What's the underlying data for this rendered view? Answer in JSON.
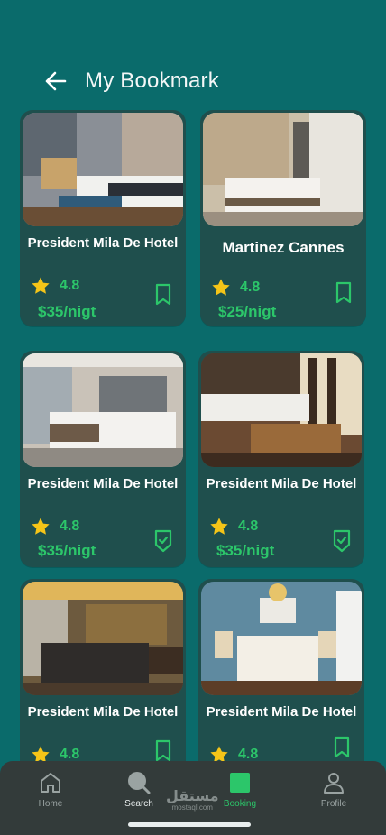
{
  "header": {
    "title": "My Bookmark"
  },
  "hotels": [
    {
      "name": "President Mila De Hotel",
      "rating": "4.8",
      "price": "$35/nigt",
      "bookmark": "bookmark-outline",
      "photo": "bedroom-blue-bench"
    },
    {
      "name": "Martinez Cannes",
      "rating": "4.8",
      "price": "$25/nigt",
      "bookmark": "bookmark-outline",
      "photo": "bedroom-patterned-wall"
    },
    {
      "name": "President Mila De Hotel",
      "rating": "4.8",
      "price": "$35/nigt",
      "bookmark": "bookmark-check",
      "photo": "bedroom-grey-headboard"
    },
    {
      "name": "President Mila De Hotel",
      "rating": "4.8",
      "price": "$35/nigt",
      "bookmark": "bookmark-check",
      "photo": "bedroom-sunlit-window"
    },
    {
      "name": "President Mila De Hotel",
      "rating": "4.8",
      "price": "",
      "bookmark": "bookmark-outline",
      "photo": "bedroom-gold-lighting"
    },
    {
      "name": "President Mila De Hotel",
      "rating": "4.8",
      "price": "",
      "bookmark": "bookmark-outline",
      "photo": "bedroom-blue-wall"
    }
  ],
  "nav": {
    "items": [
      {
        "label": "Home",
        "icon": "home-icon"
      },
      {
        "label": "Search",
        "icon": "search-icon"
      },
      {
        "label": "Booking",
        "icon": "booking-icon",
        "active": true
      },
      {
        "label": "Profile",
        "icon": "profile-icon"
      }
    ]
  },
  "watermark": {
    "arabic": "مستقل",
    "latin": "mostaql.com"
  },
  "colors": {
    "background": "#0a6b6b",
    "card": "#1f4f4d",
    "accent": "#2cc66a",
    "star": "#f5c518",
    "nav": "#333b3a"
  }
}
